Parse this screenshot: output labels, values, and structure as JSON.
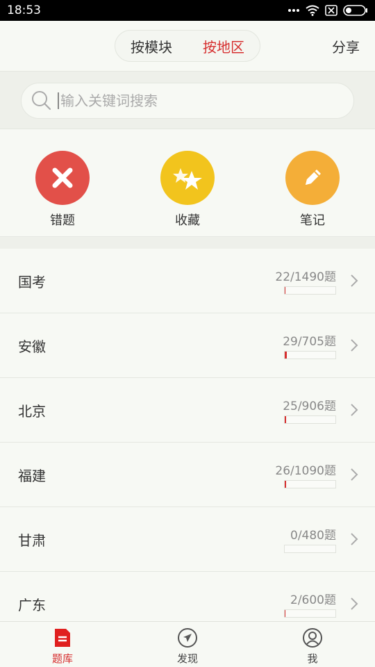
{
  "status": {
    "time": "18:53"
  },
  "header": {
    "segments": [
      {
        "label": "按模块",
        "active": false
      },
      {
        "label": "按地区",
        "active": true
      }
    ],
    "share_label": "分享"
  },
  "search": {
    "placeholder": "输入关键词搜索"
  },
  "quick_actions": [
    {
      "label": "错题",
      "icon": "close-icon",
      "color": "#e25049"
    },
    {
      "label": "收藏",
      "icon": "stars-icon",
      "color": "#f2c41d"
    },
    {
      "label": "笔记",
      "icon": "pencil-icon",
      "color": "#f4ae38"
    }
  ],
  "regions": [
    {
      "name": "国考",
      "count": "22/1490题",
      "progress": 0.0148
    },
    {
      "name": "安徽",
      "count": "29/705题",
      "progress": 0.0411
    },
    {
      "name": "北京",
      "count": "25/906题",
      "progress": 0.0276
    },
    {
      "name": "福建",
      "count": "26/1090题",
      "progress": 0.0239
    },
    {
      "name": "甘肃",
      "count": "0/480题",
      "progress": 0
    },
    {
      "name": "广东",
      "count": "2/600题",
      "progress": 0.0033
    }
  ],
  "bottom_nav": [
    {
      "label": "题库",
      "icon": "question-bank-icon",
      "active": true
    },
    {
      "label": "发现",
      "icon": "compass-icon",
      "active": false
    },
    {
      "label": "我",
      "icon": "user-icon",
      "active": false
    }
  ],
  "colors": {
    "accent": "#d62f2f"
  }
}
